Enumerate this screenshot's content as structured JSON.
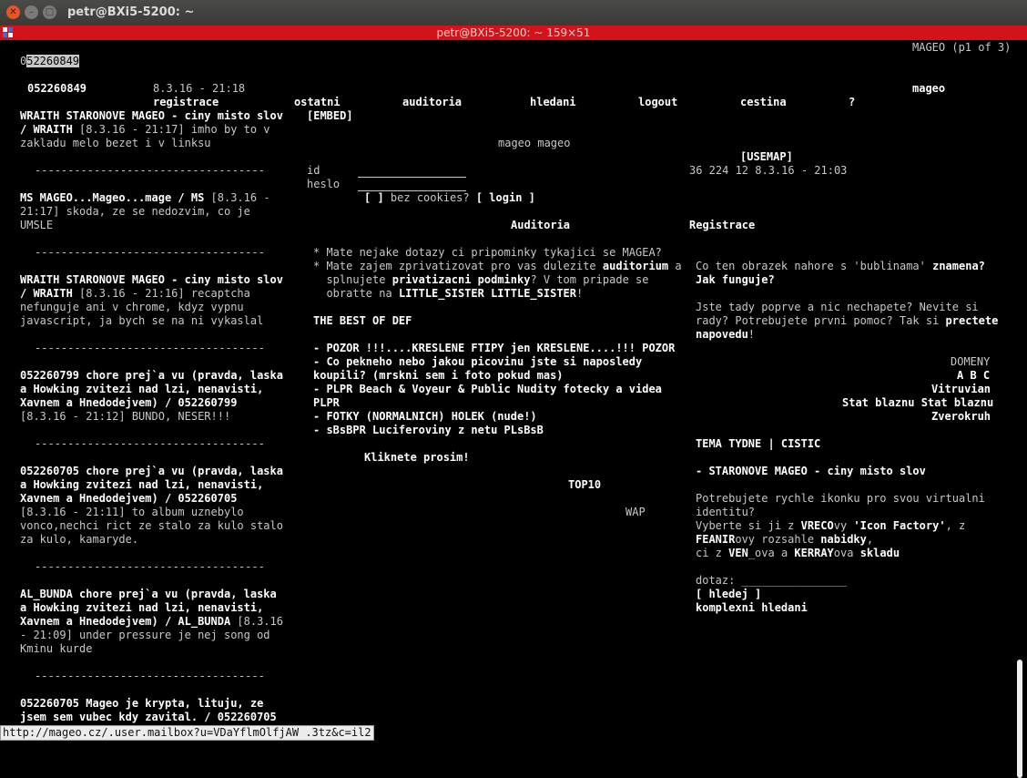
{
  "window": {
    "title": "petr@BXi5-5200: ~",
    "terminal_title": "petr@BXi5-5200: ~ 159×51",
    "status_url": "http://mageo.cz/.user.mailbox?u=VDaYflmOlfjAW .3tz&c=il2"
  },
  "page": {
    "site_info": "MAGEO (p1 of 3)",
    "input_prefix": "0",
    "input_value": "52260849",
    "user_id": "052260849",
    "datetime": "8.3.16 - 21:18",
    "site_name": "mageo"
  },
  "nav": {
    "registrace": "registrace",
    "ostatni": "ostatni",
    "auditoria": "auditoria",
    "hledani": "hledani",
    "logout": "logout",
    "cestina": "cestina",
    "help": "?"
  },
  "center": {
    "embed": "[EMBED]",
    "mageo_mageo": "mageo mageo",
    "usemap": "[USEMAP]",
    "stats": "36 224 12 8.3.16 - 21:03",
    "id_label": "id",
    "heslo_label": "heslo",
    "checkbox": "[ ]",
    "bez_cookies": "bez cookies?",
    "login": "[ login ]",
    "auditoria_heading": "Auditoria",
    "registrace_heading": "Registrace",
    "q1": "* Mate nejake dotazy ci pripominky tykajici se MAGEA?",
    "q2a": "* Mate zajem zprivatizovat pro vas dulezite",
    "q2a_b": "auditorium",
    "q2a_c": " a",
    "q2b": "  splnujete",
    "q2b_b": "privatizacni podminky",
    "q2b_c": "? V tom pripade se",
    "q2c": "  obratte na",
    "q2c_b": "LITTLE_SISTER LITTLE_SISTER",
    "q2c_c": "!",
    "best_of": "THE BEST OF DEF",
    "link1": "- POZOR !!!....KRESLENE FTIPY jen KRESLENE....!!! POZOR",
    "link2a": "- Co pekneho nebo jakou picovinu jste si naposledy",
    "link2b": "koupili? (mrskni sem i foto pokud mas)",
    "link3a": "- PLPR Beach & Voyeur & Public Nudity fotecky a videa",
    "link3b": "PLPR",
    "link4": "- FOTKY (NORMALNICH) HOLEK (nude!)",
    "link5": "- sBsBPR Luciferoviny z netu PLsBsB",
    "kliknete": "Kliknete prosim!",
    "top10": "TOP10",
    "wap": "WAP"
  },
  "right": {
    "r1a": "Co ten obrazek nahore s 'bublinama'",
    "r1a_b": "znamena?",
    "r1b": "Jak funguje?",
    "r2a": "Jste tady poprve a nic nechapete? Nevite si",
    "r2b": "rady? Potrebujete prvni pomoc? Tak si",
    "r2b_b": "prectete",
    "r2c_b": "napovedu",
    "r2c": "!",
    "domeny": "DOMENY",
    "abc": "A B C",
    "vitruvian": "Vitruvian",
    "stat_blaznu": "Stat blaznu Stat blaznu",
    "zverokruh": "Zverokruh",
    "tema": "TEMA TYDNE | CISTIC",
    "staronove": "- STARONOVE MAGEO - ciny misto slov",
    "ik1": "Potrebujete rychle ikonku pro svou virtualni",
    "ik2": "identitu?",
    "ik3a": "Vyberte si ji z",
    "ik3b": "VRECO",
    "ik3c": "vy",
    "ik3d": "'Icon Factory'",
    "ik3e": ", z",
    "ik4a": "FEANIR",
    "ik4b": "ovy rozsahle",
    "ik4c": "nabidky",
    "ik4d": ",",
    "ik5a": "ci z",
    "ik5b": "VEN",
    "ik5c": "_ova a",
    "ik5d": "KERRAY",
    "ik5e": "ova",
    "ik5f": "skladu",
    "dotaz_label": "dotaz:",
    "dotaz_field": "________________",
    "hledej": "[ hledej ]",
    "komplexni": "komplexni hledani"
  },
  "left": {
    "p1a": "WRAITH STARONOVE MAGEO - ciny misto slov",
    "p1b": "/ WRAITH",
    "p1b_n": " [8.3.16 - 21:17] imho by to v",
    "p1c": "zakladu melo bezet i v linksu",
    "sep": "-----------------------------------",
    "p2a": "MS MAGEO...Mageo...mage / MS",
    "p2a_n": " [8.3.16 -",
    "p2b": "21:17] skoda, ze se nedozvim, co je",
    "p2c": "UMSLE",
    "p3a": "WRAITH STARONOVE MAGEO - ciny misto slov",
    "p3b": "/ WRAITH",
    "p3b_n": " [8.3.16 - 21:16] recaptcha",
    "p3c": "nefunguje ani v chrome, kdyz vypnu",
    "p3d": "javascript, ja bych se na ni vykaslal",
    "p4a": "052260799 chore prej`a vu (pravda, laska",
    "p4b": "a Howking zvitezi nad lzi, nenavisti,",
    "p4c": "Xavnem a Hnedodejvem) / 052260799",
    "p4d": "[8.3.16 - 21:12] BUNDO, NESER!!!",
    "p5a": "052260705 chore prej`a vu (pravda, laska",
    "p5b": "a Howking zvitezi nad lzi, nenavisti,",
    "p5c": "Xavnem a Hnedodejvem) / 052260705",
    "p5d": "[8.3.16 - 21:11] to album uznebylo",
    "p5e": "vonco,nechci rict ze stalo za kulo stalo",
    "p5f": "za kulo, kamaryde.",
    "p6a": "AL_BUNDA chore prej`a vu (pravda, laska",
    "p6b": "a Howking zvitezi nad lzi, nenavisti,",
    "p6c": "Xavnem a Hnedodejvem) / AL_BUNDA",
    "p6c_n": " [8.3.16",
    "p6d": "- 21:09] under pressure je nej song od",
    "p6e": "Kminu kurde",
    "p7a": "052260705 Mageo je krypta, lituju, ze",
    "p7b": "jsem sem vubec kdy zavital. / 052260705"
  }
}
